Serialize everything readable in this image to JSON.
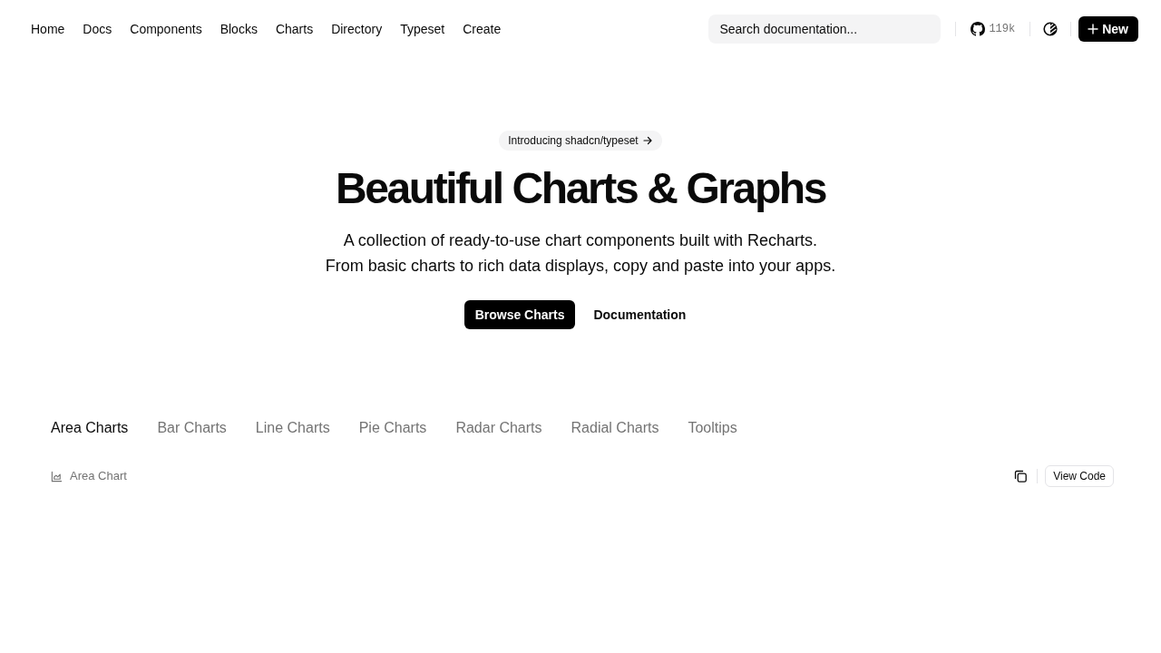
{
  "nav": {
    "links": [
      "Home",
      "Docs",
      "Components",
      "Blocks",
      "Charts",
      "Directory",
      "Typeset",
      "Create"
    ],
    "search": {
      "placeholder": "Search documentation..."
    },
    "github_stars": "119k",
    "new_button": "New"
  },
  "hero": {
    "announcement": "Introducing shadcn/typeset",
    "title": "Beautiful Charts & Graphs",
    "description": [
      "A collection of ready-to-use chart components built with Recharts.",
      "From basic charts to rich data displays, copy and paste into your apps."
    ],
    "actions": [
      {
        "label": "Browse Charts",
        "kind": "primary"
      },
      {
        "label": "Documentation",
        "kind": "ghost"
      }
    ]
  },
  "chart_tabs": [
    {
      "label": "Area Charts",
      "selected": true
    },
    {
      "label": "Bar Charts",
      "selected": false
    },
    {
      "label": "Line Charts",
      "selected": false
    },
    {
      "label": "Pie Charts",
      "selected": false
    },
    {
      "label": "Radar Charts",
      "selected": false
    },
    {
      "label": "Radial Charts",
      "selected": false
    },
    {
      "label": "Tooltips",
      "selected": false
    }
  ],
  "preview": {
    "title": "Area Chart",
    "view_code": "View Code"
  }
}
